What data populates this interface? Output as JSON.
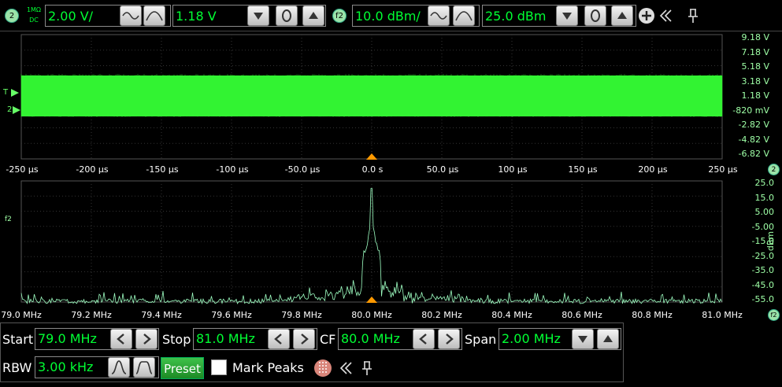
{
  "channel_badge": "2",
  "coupling": {
    "line1": "1MΩ",
    "line2": "DC"
  },
  "vertical_scale": "2.00 V/",
  "vertical_offset": "1.18 V",
  "fft_badge": "f2",
  "fft_scale": "10.0 dBm/",
  "fft_ref": "25.0 dBm",
  "time_axis": {
    "y_labels": [
      "9.18 V",
      "7.18 V",
      "5.18 V",
      "3.18 V",
      "1.18 V",
      "-820 mV",
      "-2.82 V",
      "-4.82 V",
      "-6.82 V"
    ],
    "x_labels": [
      "-250 µs",
      "-200 µs",
      "-150 µs",
      "-100 µs",
      "-50.0 µs",
      "0.0 s",
      "50.0 µs",
      "100 µs",
      "150 µs",
      "200 µs",
      "250 µs"
    ],
    "trigger_marker": "T",
    "channel_marker": "2",
    "badge": "2"
  },
  "freq_axis": {
    "y_labels": [
      "25.0",
      "15.0",
      "5.00",
      "-5.00",
      "-15.0",
      "-25.0",
      "-35.0",
      "-45.0",
      "-55.0"
    ],
    "x_labels": [
      "79.0 MHz",
      "79.2 MHz",
      "79.4 MHz",
      "79.6 MHz",
      "79.8 MHz",
      "80.0 MHz",
      "80.2 MHz",
      "80.4 MHz",
      "80.6 MHz",
      "80.8 MHz",
      "81.0 MHz"
    ],
    "unit": "dBm",
    "marker": "f2",
    "badge": "f2"
  },
  "controls": {
    "start_label": "Start",
    "start_value": "79.0 MHz",
    "stop_label": "Stop",
    "stop_value": "81.0 MHz",
    "cf_label": "CF",
    "cf_value": "80.0 MHz",
    "span_label": "Span",
    "span_value": "2.00 MHz",
    "rbw_label": "RBW",
    "rbw_value": "3.00 kHz",
    "preset_label": "Preset",
    "mark_peaks_label": "Mark Peaks"
  },
  "colors": {
    "trace": "#33ff33",
    "spectrum": "#9effc2",
    "accent_green": "#00ff33"
  }
}
